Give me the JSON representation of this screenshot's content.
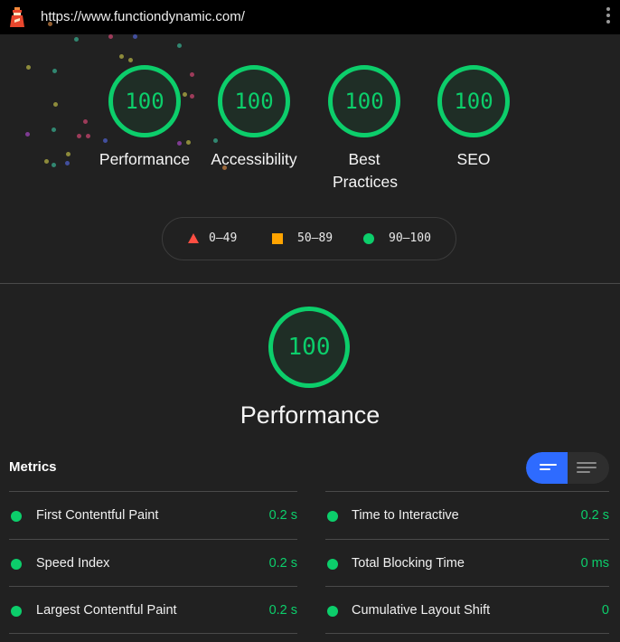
{
  "browser": {
    "url": "https://www.functiondynamic.com/",
    "logo_icon": "lighthouse-icon",
    "menu_icon": "more-vert-icon"
  },
  "colors": {
    "pass": "#0cce6b",
    "average": "#ffa400",
    "fail": "#ff4e42",
    "toggle_active": "#2e6bff",
    "background": "#212121"
  },
  "categories": [
    {
      "label": "Performance",
      "score": "100"
    },
    {
      "label": "Accessibility",
      "score": "100"
    },
    {
      "label": "Best Practices",
      "score": "100"
    },
    {
      "label": "SEO",
      "score": "100"
    }
  ],
  "legend": [
    {
      "shape": "triangle",
      "range": "0–49"
    },
    {
      "shape": "square",
      "range": "50–89"
    },
    {
      "shape": "circle",
      "range": "90–100"
    }
  ],
  "performance": {
    "score": "100",
    "title": "Performance"
  },
  "metrics": {
    "title": "Metrics",
    "view_toggle": {
      "options": [
        "compact-view",
        "expanded-view"
      ],
      "selected": "compact-view"
    },
    "left": [
      {
        "name": "First Contentful Paint",
        "value": "0.2 s"
      },
      {
        "name": "Speed Index",
        "value": "0.2 s"
      },
      {
        "name": "Largest Contentful Paint",
        "value": "0.2 s"
      }
    ],
    "right": [
      {
        "name": "Time to Interactive",
        "value": "0.2 s"
      },
      {
        "name": "Total Blocking Time",
        "value": "0 ms"
      },
      {
        "name": "Cumulative Layout Shift",
        "value": "0"
      }
    ]
  }
}
